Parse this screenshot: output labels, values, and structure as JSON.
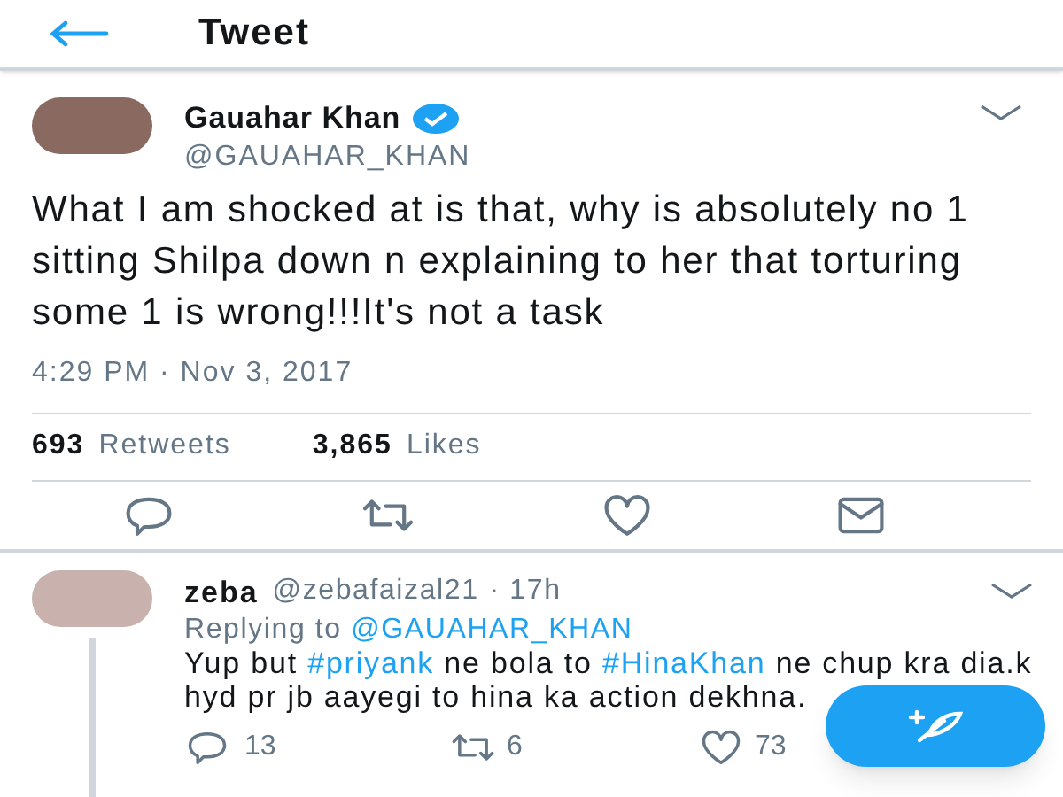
{
  "header": {
    "title": "Tweet"
  },
  "tweet": {
    "name": "Gauahar Khan",
    "verified": true,
    "handle": "@GAUAHAR_KHAN",
    "text": "What I am shocked at is that, why is absolutely no 1 sitting Shilpa down n explaining to her that torturing some 1 is wrong!!!It's not a task",
    "time": "4:29 PM · Nov 3, 2017",
    "stats": [
      {
        "count": "693",
        "label": "Retweets"
      },
      {
        "count": "3,865",
        "label": "Likes"
      }
    ]
  },
  "reply": {
    "name": "zeba",
    "handle": "@zebafaizal21",
    "age": "· 17h",
    "replying_label": "Replying to",
    "replying_to": "@GAUAHAR_KHAN",
    "segments": [
      {
        "kind": "plain",
        "text": "Yup but "
      },
      {
        "kind": "hashtag",
        "text": "#priyank"
      },
      {
        "kind": "plain",
        "text": " ne bola to "
      },
      {
        "kind": "hashtag",
        "text": "#HinaKhan"
      },
      {
        "kind": "plain",
        "text": " ne chup kra dia.k hyd pr jb aayegi to hina ka action dekhna."
      }
    ],
    "reply_count": "13",
    "retweet_count": "6",
    "like_count": "73"
  }
}
